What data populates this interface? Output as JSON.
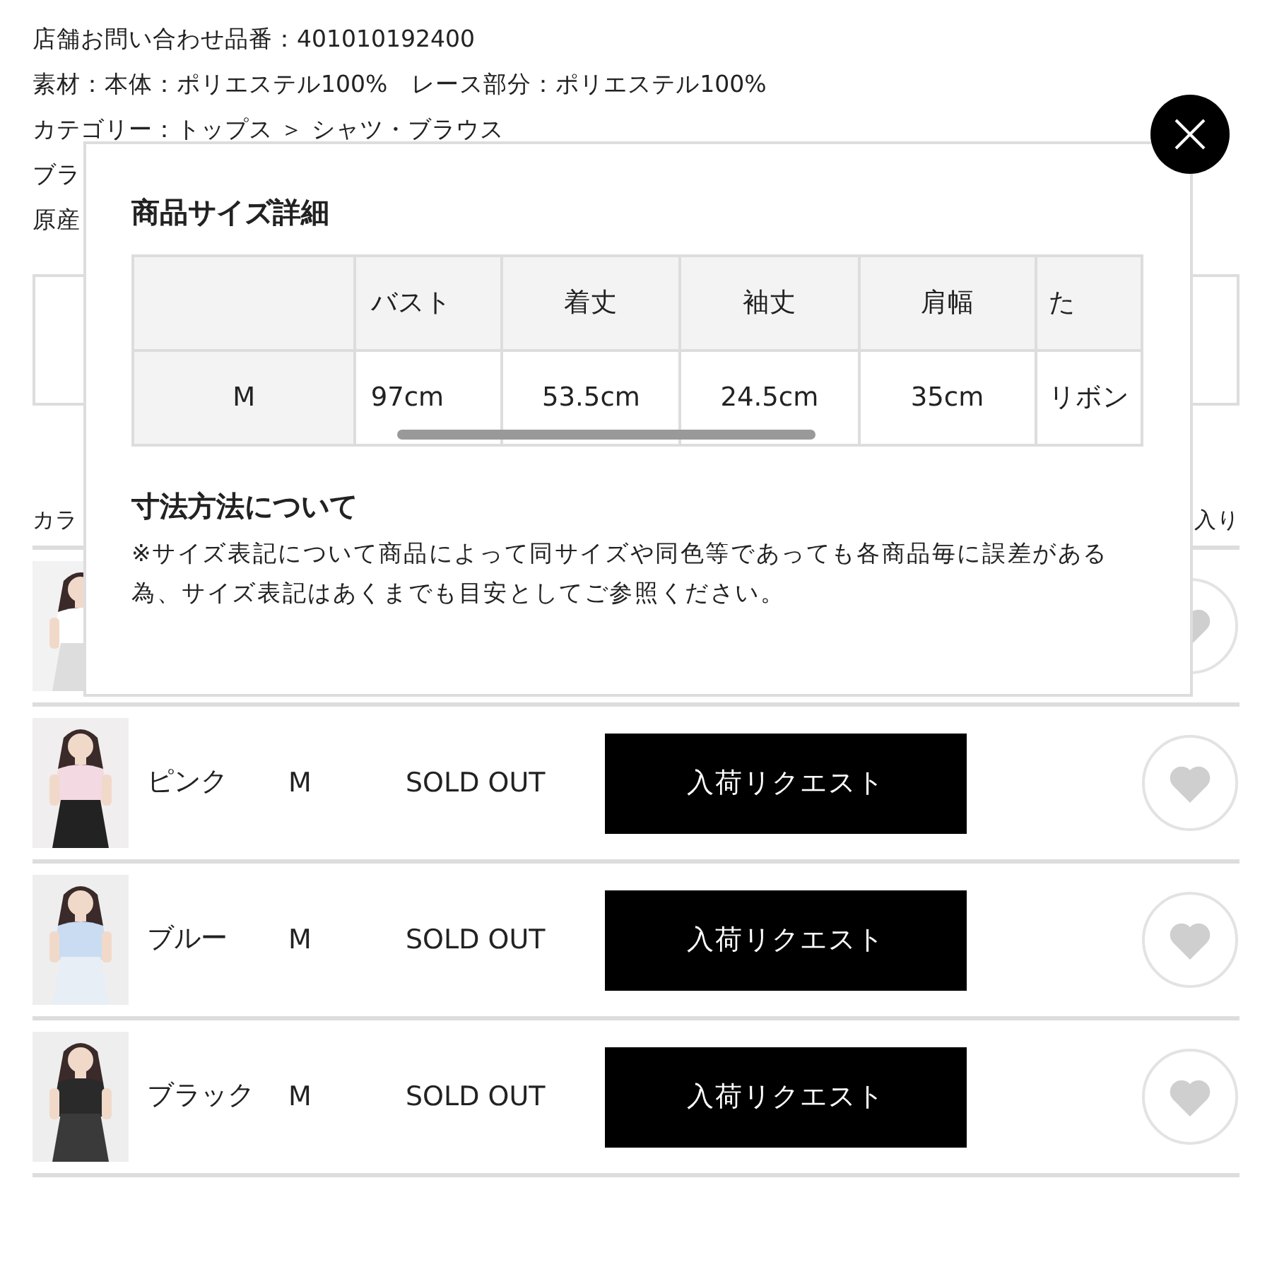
{
  "product_info": [
    "店舗お問い合わせ品番：401010192400",
    "素材：本体：ポリエステル100%　レース部分：ポリエステル100%",
    "カテゴリー：トップス ＞ シャツ・ブラウス",
    "ブラ",
    "原産"
  ],
  "stock_header": {
    "column_1": "カラ",
    "column_2": "入り"
  },
  "stock_rows": [
    {
      "kind": "hidden",
      "favorite": false
    },
    {
      "kind": "full",
      "color_name": "ピンク",
      "size": "M",
      "status": "SOLD OUT",
      "button": "入荷リクエスト",
      "favorite": false
    },
    {
      "kind": "full",
      "color_name": "ブルー",
      "size": "M",
      "status": "SOLD OUT",
      "button": "入荷リクエスト",
      "favorite": false
    },
    {
      "kind": "full",
      "color_name": "ブラック",
      "size": "M",
      "status": "SOLD OUT",
      "button": "入荷リクエスト",
      "favorite": false
    }
  ],
  "size_modal": {
    "title": "商品サイズ詳細",
    "table": {
      "columns": [
        "",
        "バスト",
        "着丈",
        "袖丈",
        "肩幅",
        "た"
      ],
      "rows": [
        [
          "M",
          "97cm",
          "53.5cm",
          "24.5cm",
          "35cm",
          "リボン"
        ]
      ]
    },
    "measure_title": "寸法方法について",
    "measure_note": "※サイズ表記について商品によって同サイズや同色等であっても各商品毎に誤差がある為、サイズ表記はあくまでも目安としてご参照ください。"
  }
}
